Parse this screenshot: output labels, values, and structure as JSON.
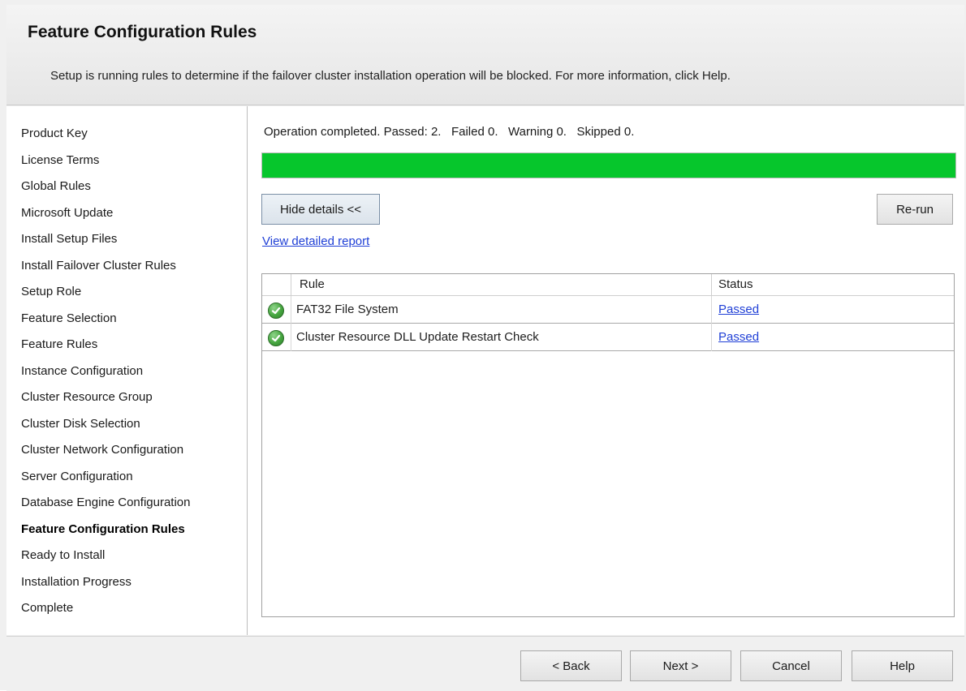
{
  "header": {
    "title": "Feature Configuration Rules",
    "description": "Setup is running rules to determine if the failover cluster installation operation will be blocked. For more information, click Help."
  },
  "sidebar": {
    "items": [
      {
        "label": "Product Key"
      },
      {
        "label": "License Terms"
      },
      {
        "label": "Global Rules"
      },
      {
        "label": "Microsoft Update"
      },
      {
        "label": "Install Setup Files"
      },
      {
        "label": "Install Failover Cluster Rules"
      },
      {
        "label": "Setup Role"
      },
      {
        "label": "Feature Selection"
      },
      {
        "label": "Feature Rules"
      },
      {
        "label": "Instance Configuration"
      },
      {
        "label": "Cluster Resource Group"
      },
      {
        "label": "Cluster Disk Selection"
      },
      {
        "label": "Cluster Network Configuration"
      },
      {
        "label": "Server Configuration"
      },
      {
        "label": "Database Engine Configuration"
      },
      {
        "label": "Feature Configuration Rules",
        "active": true
      },
      {
        "label": "Ready to Install"
      },
      {
        "label": "Installation Progress"
      },
      {
        "label": "Complete"
      }
    ]
  },
  "main": {
    "status_text": "Operation completed. Passed: 2.   Failed 0.   Warning 0.   Skipped 0.",
    "progress_fraction": 1.0,
    "progress_color": "#06c62c",
    "hide_details_label": "Hide details <<",
    "rerun_label": "Re-run",
    "report_link": "View detailed report",
    "grid": {
      "columns": {
        "rule": "Rule",
        "status": "Status"
      },
      "rows": [
        {
          "icon": "check-circle-icon",
          "rule": "FAT32 File System",
          "status": "Passed"
        },
        {
          "icon": "check-circle-icon",
          "rule": "Cluster Resource DLL Update Restart Check",
          "status": "Passed"
        }
      ]
    }
  },
  "footer": {
    "back_label": "< Back",
    "next_label": "Next >",
    "cancel_label": "Cancel",
    "help_label": "Help"
  }
}
